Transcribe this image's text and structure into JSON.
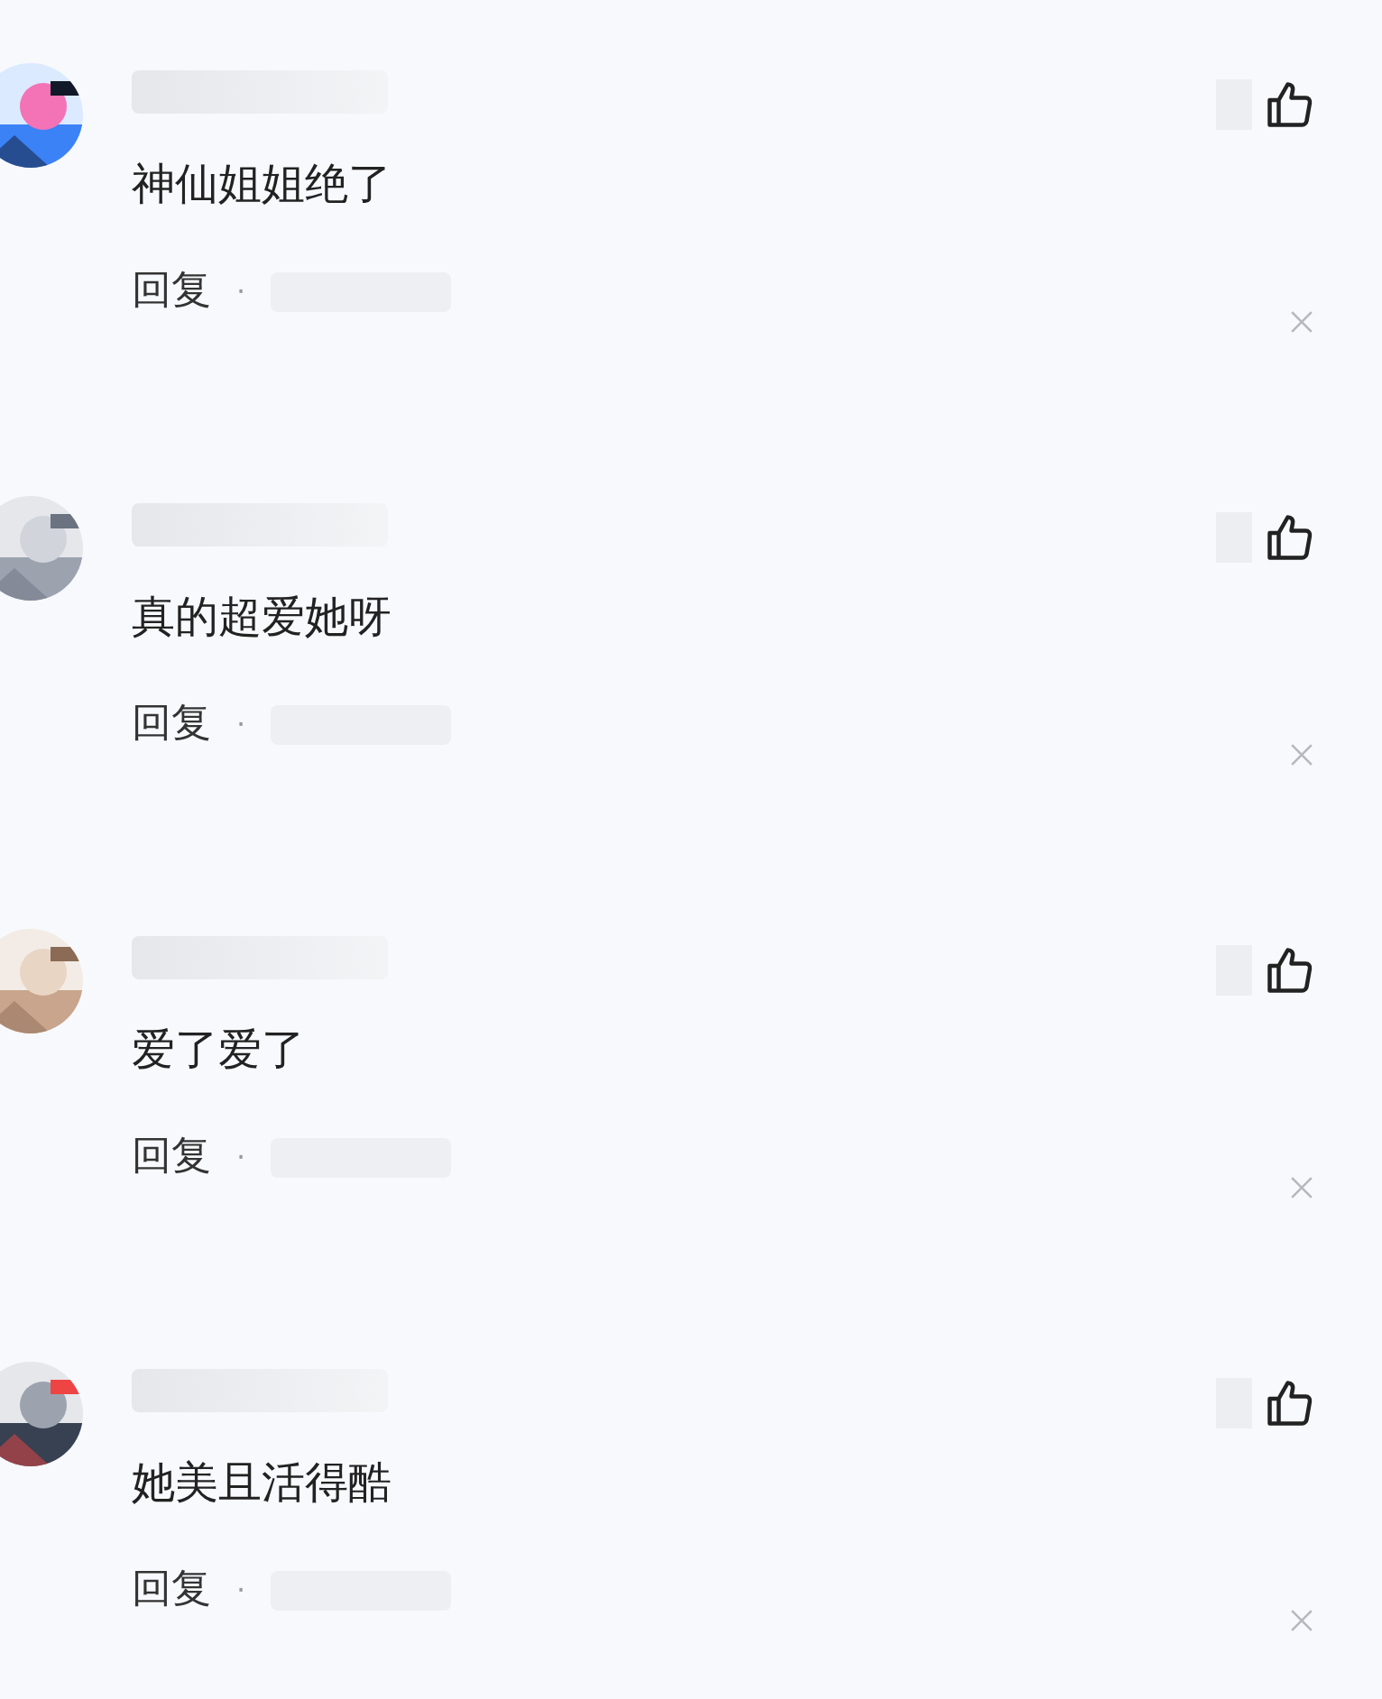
{
  "comments": [
    {
      "text": "神仙姐姐绝了",
      "reply": "回复",
      "separator": "·"
    },
    {
      "text": "真的超爱她呀",
      "reply": "回复",
      "separator": "·"
    },
    {
      "text": "爱了爱了",
      "reply": "回复",
      "separator": "·"
    },
    {
      "text": "她美且活得酷",
      "reply": "回复",
      "separator": "·"
    }
  ]
}
